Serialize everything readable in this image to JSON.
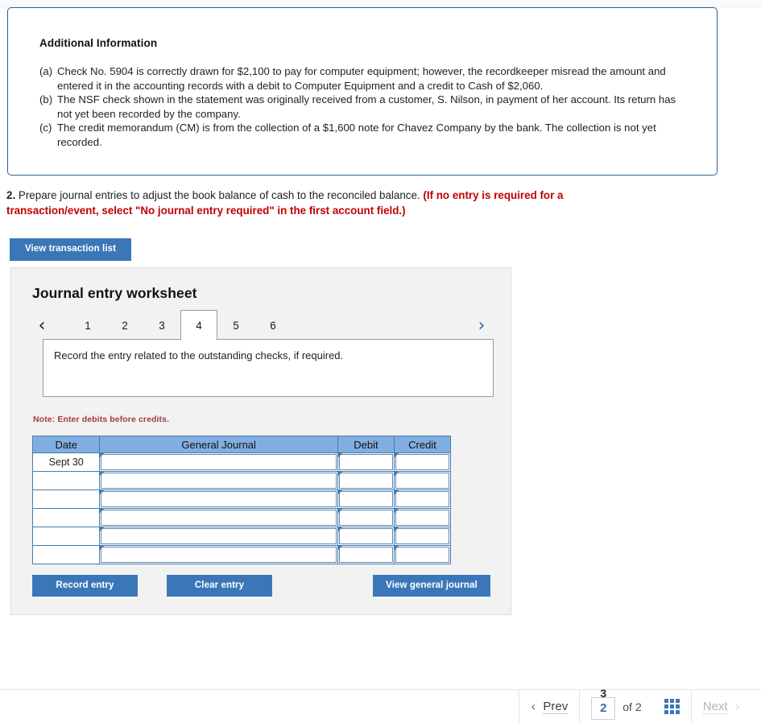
{
  "additional_info": {
    "title": "Additional Information",
    "items": [
      {
        "marker": "(a)",
        "text": "Check No. 5904 is correctly drawn for $2,100 to pay for computer equipment; however, the recordkeeper misread the amount and entered it in the accounting records with a debit to Computer Equipment and a credit to Cash of $2,060."
      },
      {
        "marker": "(b)",
        "text": "The NSF check shown in the statement was originally received from a customer, S. Nilson, in payment of her account. Its return has not yet been recorded by the company."
      },
      {
        "marker": "(c)",
        "text": "The credit memorandum (CM) is from the collection of a $1,600 note for Chavez Company by the bank. The collection is not yet recorded."
      }
    ]
  },
  "question": {
    "number": "2.",
    "text": "Prepare journal entries to adjust the book balance of cash to the reconciled balance.",
    "red_note": "(If no entry is required for a transaction/event, select \"No journal entry required\" in the first account field.)"
  },
  "view_transaction_list_label": "View transaction list",
  "worksheet": {
    "title": "Journal entry worksheet",
    "prev_arrow": "‹",
    "next_arrow": "›",
    "tabs": [
      {
        "label": "1",
        "active": false
      },
      {
        "label": "2",
        "active": false
      },
      {
        "label": "3",
        "active": false
      },
      {
        "label": "4",
        "active": true
      },
      {
        "label": "5",
        "active": false
      },
      {
        "label": "6",
        "active": false
      }
    ],
    "instruction": "Record the entry related to the outstanding checks, if required.",
    "note": "Note: Enter debits before credits.",
    "table": {
      "headers": [
        "Date",
        "General Journal",
        "Debit",
        "Credit"
      ],
      "rows": [
        {
          "date": "Sept 30",
          "general_journal": "",
          "debit": "",
          "credit": ""
        },
        {
          "date": "",
          "general_journal": "",
          "debit": "",
          "credit": ""
        },
        {
          "date": "",
          "general_journal": "",
          "debit": "",
          "credit": ""
        },
        {
          "date": "",
          "general_journal": "",
          "debit": "",
          "credit": ""
        },
        {
          "date": "",
          "general_journal": "",
          "debit": "",
          "credit": ""
        },
        {
          "date": "",
          "general_journal": "",
          "debit": "",
          "credit": ""
        }
      ]
    },
    "buttons": {
      "record": "Record entry",
      "clear": "Clear entry",
      "view_general_journal": "View general journal"
    }
  },
  "footer": {
    "prev_label": "Prev",
    "next_label": "Next",
    "page_current": "2",
    "page_ghost": "3",
    "of_label": "of",
    "page_total": "2",
    "grid_icon": "grid-icon"
  },
  "colors": {
    "accent_blue": "#3b77b8",
    "panel_border_blue": "#2f6193",
    "table_header_blue": "#81aee0",
    "note_red": "#a83a3a",
    "prompt_red": "#c00000"
  }
}
